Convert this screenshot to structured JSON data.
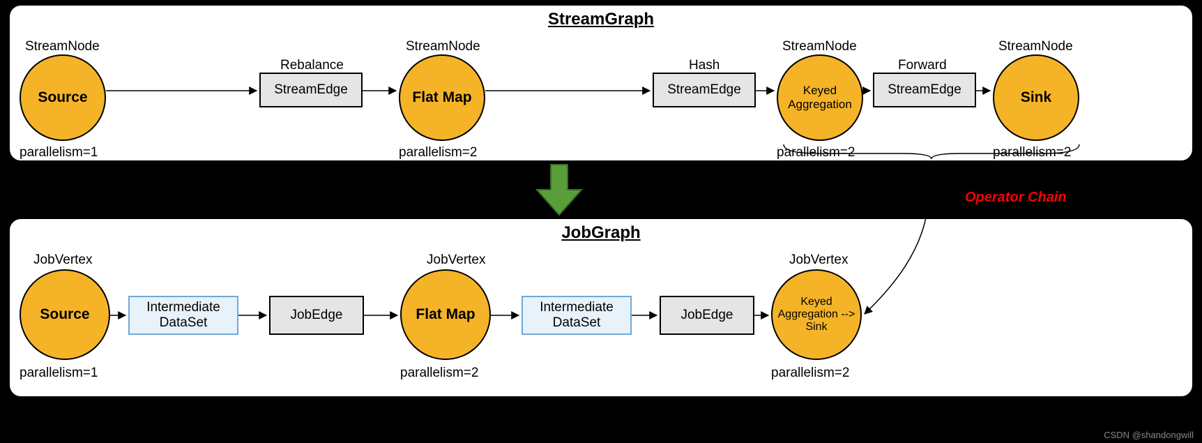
{
  "streamgraph": {
    "title": "StreamGraph",
    "nodes": {
      "source": {
        "top_label": "StreamNode",
        "text": "Source",
        "bottom_label": "parallelism=1"
      },
      "flatmap": {
        "top_label": "StreamNode",
        "text": "Flat Map",
        "bottom_label": "parallelism=2"
      },
      "keyed": {
        "top_label": "StreamNode",
        "text": "Keyed Aggregation",
        "bottom_label": "parallelism=2"
      },
      "sink": {
        "top_label": "StreamNode",
        "text": "Sink",
        "bottom_label": "parallelism=2"
      }
    },
    "edges": {
      "e1": {
        "top_label": "Rebalance",
        "text": "StreamEdge"
      },
      "e2": {
        "top_label": "Hash",
        "text": "StreamEdge"
      },
      "e3": {
        "top_label": "Forward",
        "text": "StreamEdge"
      }
    }
  },
  "jobgraph": {
    "title": "JobGraph",
    "nodes": {
      "source": {
        "top_label": "JobVertex",
        "text": "Source",
        "bottom_label": "parallelism=1"
      },
      "flatmap": {
        "top_label": "JobVertex",
        "text": "Flat Map",
        "bottom_label": "parallelism=2"
      },
      "keyed": {
        "top_label": "JobVertex",
        "text": "Keyed Aggregation --> Sink",
        "bottom_label": "parallelism=2"
      }
    },
    "ids1": {
      "text": "Intermediate DataSet"
    },
    "ids2": {
      "text": "Intermediate DataSet"
    },
    "je1": {
      "text": "JobEdge"
    },
    "je2": {
      "text": "JobEdge"
    }
  },
  "operator_chain_label": "Operator Chain",
  "watermark": "CSDN @shandongwill"
}
